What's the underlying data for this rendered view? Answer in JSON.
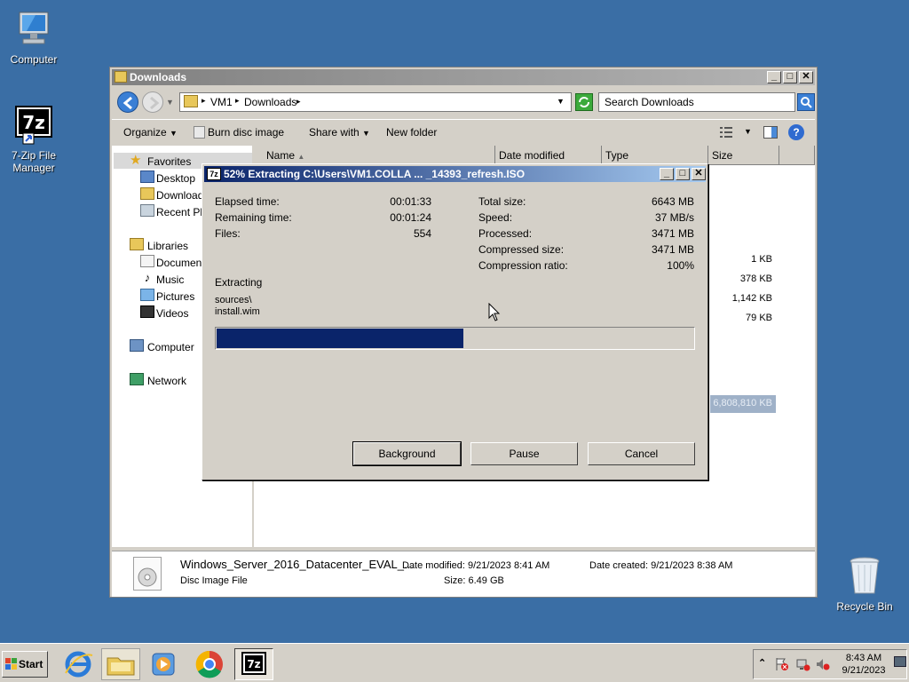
{
  "desktop": {
    "icons": [
      {
        "label": "Computer"
      },
      {
        "label": "7-Zip File Manager"
      },
      {
        "label": "Recycle Bin"
      }
    ]
  },
  "explorer": {
    "title": "Downloads",
    "breadcrumb": [
      "VM1",
      "Downloads"
    ],
    "search_placeholder": "Search Downloads",
    "toolbar": {
      "organize": "Organize",
      "burn": "Burn disc image",
      "share": "Share with",
      "new_folder": "New folder"
    },
    "nav": {
      "favorites": "Favorites",
      "desktop": "Desktop",
      "downloads": "Downloads",
      "recent": "Recent Places",
      "libraries": "Libraries",
      "documents": "Documents",
      "music": "Music",
      "pictures": "Pictures",
      "videos": "Videos",
      "computer": "Computer",
      "network": "Network"
    },
    "columns": {
      "name": "Name",
      "date": "Date modified",
      "type": "Type",
      "size": "Size"
    },
    "file_sizes": [
      "1 KB",
      "378 KB",
      "1,142 KB",
      "79 KB",
      "6,808,810 KB"
    ],
    "details": {
      "filename": "Windows_Server_2016_Datacenter_EVAL_...",
      "filetype": "Disc Image File",
      "date_modified": "Date modified:  9/21/2023 8:41 AM",
      "size": "Size:  6.49 GB",
      "date_created": "Date created:  9/21/2023 8:38 AM"
    }
  },
  "dialog": {
    "title": "52% Extracting C:\\Users\\VM1.COLLA ... _14393_refresh.ISO",
    "progress_percent": 52,
    "left_stats": [
      {
        "label": "Elapsed time:",
        "value": "00:01:33"
      },
      {
        "label": "Remaining time:",
        "value": "00:01:24"
      },
      {
        "label": "Files:",
        "value": "554"
      }
    ],
    "right_stats": [
      {
        "label": "Total size:",
        "value": "6643 MB"
      },
      {
        "label": "Speed:",
        "value": "37 MB/s"
      },
      {
        "label": "Processed:",
        "value": "3471 MB"
      },
      {
        "label": "Compressed size:",
        "value": "3471 MB"
      },
      {
        "label": "Compression ratio:",
        "value": "100%"
      }
    ],
    "operation": "Extracting",
    "current_dir": "sources\\",
    "current_file": "install.wim",
    "buttons": {
      "background": "Background",
      "pause": "Pause",
      "cancel": "Cancel"
    }
  },
  "taskbar": {
    "start": "Start",
    "time": "8:43 AM",
    "date": "9/21/2023"
  },
  "colors": {
    "desktop": "#3a6ea5",
    "progress": "#0a246a",
    "dialog_title": "#0a246a"
  }
}
